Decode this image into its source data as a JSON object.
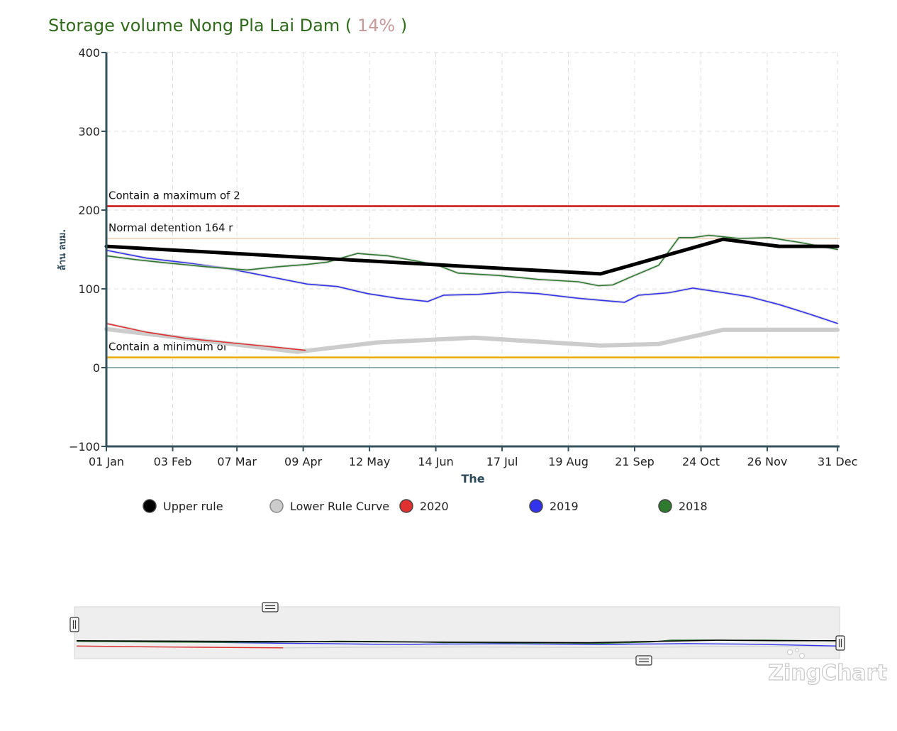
{
  "header": {
    "title": "Storage volume Nong Pla Lai Dam (",
    "percent": "14%",
    "title_end": ")"
  },
  "watermark": "ZingChart",
  "colors": {
    "title": "#2f6b1a",
    "percent": "#c8999b",
    "upper_rule": "#000000",
    "lower_rule": "#cccccc",
    "y2020": "#e03030",
    "y2019": "#3333ee",
    "y2018": "#2e7a2e",
    "max_line": "#cc1111",
    "normal_line": "#f6d9bf",
    "min_line": "#f0a800",
    "zero_line": "#4a7f86",
    "axis": "#36525c",
    "grid": "#dddddd"
  },
  "chart_data": {
    "type": "line",
    "title": "Storage volume Nong Pla Lai Dam ( 14% )",
    "xlabel": "The",
    "ylabel": "ล้าน ลบม.",
    "xlim": [
      0,
      365
    ],
    "ylim": [
      -100,
      400
    ],
    "y_ticks": [
      -100,
      0,
      100,
      200,
      300,
      400
    ],
    "y_tick_labels": [
      "−100",
      "0",
      "100",
      "200",
      "300",
      "400"
    ],
    "x_ticks": [
      {
        "day": 0,
        "label": "01 Jan"
      },
      {
        "day": 33,
        "label": "03 Feb"
      },
      {
        "day": 65,
        "label": "07 Mar"
      },
      {
        "day": 98,
        "label": "09 Apr"
      },
      {
        "day": 131,
        "label": "12 May"
      },
      {
        "day": 164,
        "label": "14 Jun"
      },
      {
        "day": 197,
        "label": "17 Jul"
      },
      {
        "day": 230,
        "label": "19 Aug"
      },
      {
        "day": 263,
        "label": "21 Sep"
      },
      {
        "day": 296,
        "label": "24 Oct"
      },
      {
        "day": 329,
        "label": "26 Nov"
      },
      {
        "day": 364,
        "label": "31 Dec"
      }
    ],
    "grid": true,
    "legend_position": "bottom",
    "reference_lines": [
      {
        "key": "max",
        "value": 205,
        "label": "Contain a maximum of 2"
      },
      {
        "key": "normal",
        "value": 164,
        "label": "Normal detention 164 r"
      },
      {
        "key": "min",
        "value": 13,
        "label": "Contain a minimum of"
      }
    ],
    "series": [
      {
        "name": "Upper rule",
        "key": "upper_rule",
        "width": 5,
        "points": [
          [
            0,
            154
          ],
          [
            246,
            119
          ],
          [
            307,
            163
          ],
          [
            335,
            154
          ],
          [
            364,
            154
          ]
        ]
      },
      {
        "name": "Lower Rule Curve",
        "key": "lower_rule",
        "width": 6,
        "points": [
          [
            0,
            49
          ],
          [
            95,
            20
          ],
          [
            135,
            32
          ],
          [
            183,
            38
          ],
          [
            246,
            28
          ],
          [
            275,
            30
          ],
          [
            307,
            48
          ],
          [
            364,
            48
          ]
        ]
      },
      {
        "name": "2020",
        "key": "y2020",
        "width": 1.6,
        "points": [
          [
            0,
            56
          ],
          [
            20,
            45
          ],
          [
            40,
            37
          ],
          [
            60,
            32
          ],
          [
            80,
            27
          ],
          [
            99,
            22
          ]
        ]
      },
      {
        "name": "2019",
        "key": "y2019",
        "width": 1.6,
        "points": [
          [
            0,
            149
          ],
          [
            20,
            139
          ],
          [
            40,
            133
          ],
          [
            60,
            126
          ],
          [
            80,
            116
          ],
          [
            100,
            106
          ],
          [
            115,
            103
          ],
          [
            130,
            94
          ],
          [
            145,
            88
          ],
          [
            160,
            84
          ],
          [
            168,
            92
          ],
          [
            185,
            93
          ],
          [
            200,
            96
          ],
          [
            215,
            94
          ],
          [
            235,
            88
          ],
          [
            248,
            85
          ],
          [
            258,
            83
          ],
          [
            265,
            92
          ],
          [
            280,
            95
          ],
          [
            292,
            101
          ],
          [
            305,
            96
          ],
          [
            320,
            90
          ],
          [
            335,
            80
          ],
          [
            350,
            68
          ],
          [
            364,
            56
          ]
        ]
      },
      {
        "name": "2018",
        "key": "y2018",
        "width": 1.6,
        "points": [
          [
            0,
            142
          ],
          [
            15,
            137
          ],
          [
            30,
            133
          ],
          [
            50,
            128
          ],
          [
            70,
            124
          ],
          [
            85,
            128
          ],
          [
            100,
            131
          ],
          [
            110,
            134
          ],
          [
            125,
            145
          ],
          [
            140,
            142
          ],
          [
            155,
            135
          ],
          [
            165,
            130
          ],
          [
            175,
            120
          ],
          [
            195,
            117
          ],
          [
            215,
            112
          ],
          [
            235,
            109
          ],
          [
            245,
            104
          ],
          [
            252,
            105
          ],
          [
            262,
            116
          ],
          [
            275,
            130
          ],
          [
            285,
            165
          ],
          [
            292,
            165
          ],
          [
            300,
            168
          ],
          [
            315,
            164
          ],
          [
            330,
            165
          ],
          [
            345,
            159
          ],
          [
            364,
            150
          ]
        ]
      }
    ],
    "legend": [
      {
        "label": "Upper rule",
        "key": "upper_rule"
      },
      {
        "label": "Lower Rule Curve",
        "key": "lower_rule"
      },
      {
        "label": "2020",
        "key": "y2020"
      },
      {
        "label": "2019",
        "key": "y2019"
      },
      {
        "label": "2018",
        "key": "y2018"
      }
    ]
  }
}
